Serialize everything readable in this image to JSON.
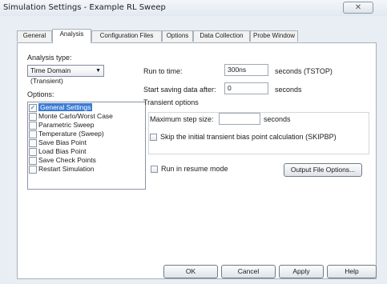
{
  "window": {
    "title": "Simulation Settings - Example RL Sweep",
    "close_glyph": "✕"
  },
  "tabs": [
    {
      "label": "General"
    },
    {
      "label": "Analysis",
      "active": true
    },
    {
      "label": "Configuration Files"
    },
    {
      "label": "Options"
    },
    {
      "label": "Data Collection"
    },
    {
      "label": "Probe Window"
    }
  ],
  "analysis": {
    "type_label": "Analysis type:",
    "type_value": "Time Domain (Transient)",
    "options_label": "Options:",
    "options": [
      {
        "label": "General Settings",
        "checked": true,
        "selected": true
      },
      {
        "label": "Monte Carlo/Worst Case",
        "checked": false
      },
      {
        "label": "Parametric Sweep",
        "checked": false
      },
      {
        "label": "Temperature (Sweep)",
        "checked": false
      },
      {
        "label": "Save Bias Point",
        "checked": false
      },
      {
        "label": "Load Bias Point",
        "checked": false
      },
      {
        "label": "Save Check Points",
        "checked": false
      },
      {
        "label": "Restart Simulation",
        "checked": false
      }
    ]
  },
  "settings": {
    "run_to_time_label": "Run to time:",
    "run_to_time_value": "300ns",
    "run_to_time_unit": "seconds  (TSTOP)",
    "start_saving_label": "Start saving data after:",
    "start_saving_value": "0",
    "start_saving_unit": "seconds",
    "transient_options_label": "Transient options",
    "max_step_label": "Maximum step size:",
    "max_step_value": "",
    "max_step_unit": "seconds",
    "skip_bias_label": "Skip the initial transient bias point calculation  (SKIPBP)",
    "skip_bias_checked": false,
    "resume_mode_label": "Run in resume mode",
    "resume_mode_checked": false,
    "output_file_options_label": "Output File Options..."
  },
  "buttons": {
    "ok": "OK",
    "cancel": "Cancel",
    "apply": "Apply",
    "help": "Help"
  }
}
